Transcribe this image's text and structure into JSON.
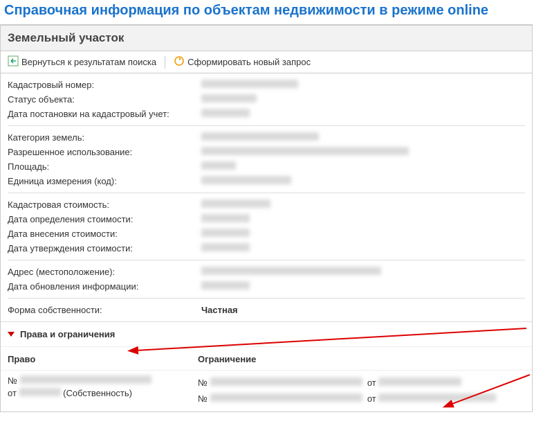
{
  "page_title": "Справочная информация по объектам недвижимости в режиме online",
  "panel_title": "Земельный участок",
  "toolbar": {
    "back_label": "Вернуться к результатам поиска",
    "new_query_label": "Сформировать новый запрос"
  },
  "sections": {
    "s1": {
      "cad_number_label": "Кадастровый номер:",
      "status_label": "Статус объекта:",
      "reg_date_label": "Дата постановки на кадастровый учет:"
    },
    "s2": {
      "category_label": "Категория земель:",
      "usage_label": "Разрешенное использование:",
      "area_label": "Площадь:",
      "unit_label": "Единица измерения (код):"
    },
    "s3": {
      "cad_cost_label": "Кадастровая стоимость:",
      "cost_def_date_label": "Дата определения стоимости:",
      "cost_entry_date_label": "Дата внесения стоимости:",
      "cost_appr_date_label": "Дата утверждения стоимости:"
    },
    "s4": {
      "address_label": "Адрес (местоположение):",
      "update_date_label": "Дата обновления информации:"
    },
    "s5": {
      "ownership_form_label": "Форма собственности:",
      "ownership_form_value": "Частная"
    }
  },
  "accordion": {
    "rights_title": "Права и ограничения"
  },
  "rights_table": {
    "head_right": "Право",
    "head_restriction": "Ограничение",
    "row": {
      "num_prefix": "№",
      "from_prefix": "от",
      "ownership_type": "(Собственность)"
    }
  }
}
